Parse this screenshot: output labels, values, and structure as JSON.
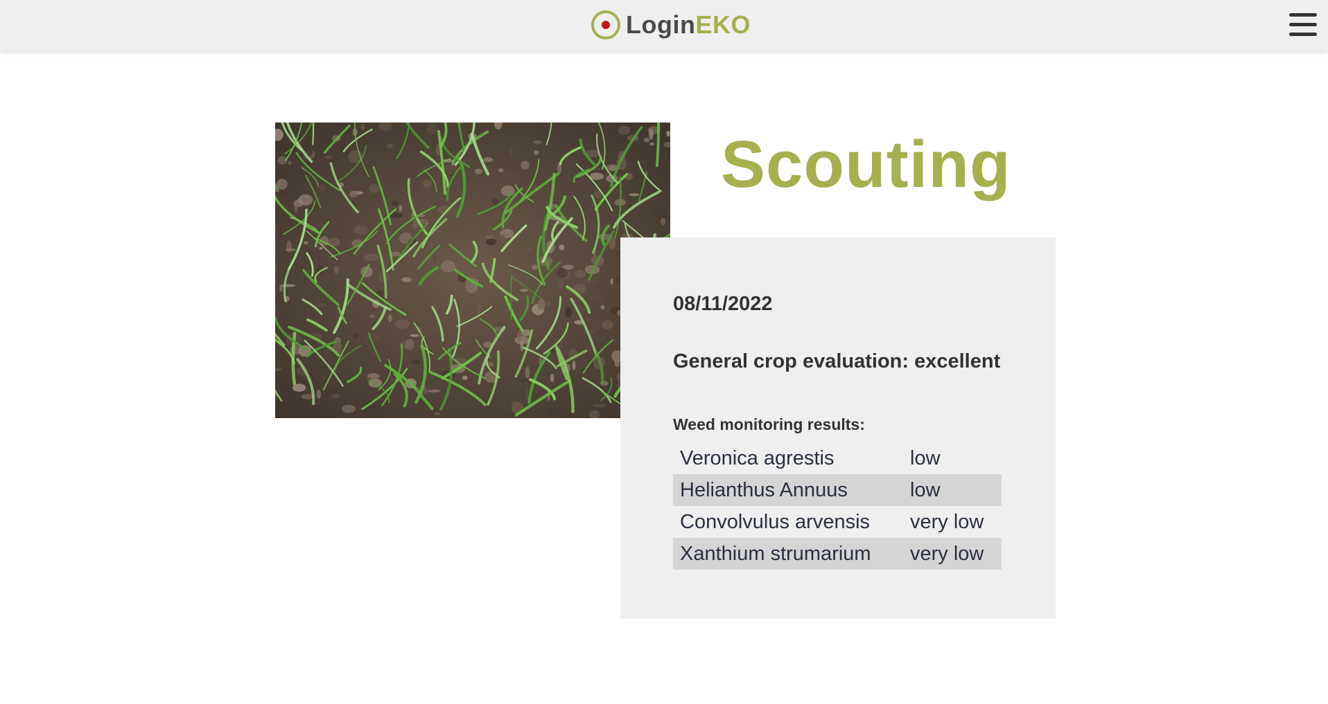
{
  "header": {
    "logo_login": "Login",
    "logo_eko": "EKO",
    "logo_icon": "record-dot-icon",
    "menu_icon": "hamburger-menu-icon"
  },
  "page": {
    "title": "Scouting"
  },
  "photo": {
    "subject": "field-photo"
  },
  "scouting": {
    "date": "08/11/2022",
    "evaluation": "General crop evaluation: excellent",
    "weed_heading": "Weed monitoring results:",
    "weeds": [
      {
        "name": "Veronica agrestis",
        "level": "low"
      },
      {
        "name": "Helianthus Annuus",
        "level": "low"
      },
      {
        "name": "Convolvulus arvensis",
        "level": "very low"
      },
      {
        "name": "Xanthium strumarium",
        "level": "very low"
      }
    ]
  },
  "colors": {
    "accent": "#a6b04f",
    "logo_dot": "#d0101a",
    "card_bg": "#efefef",
    "row_alt_bg": "#d5d5d5"
  }
}
